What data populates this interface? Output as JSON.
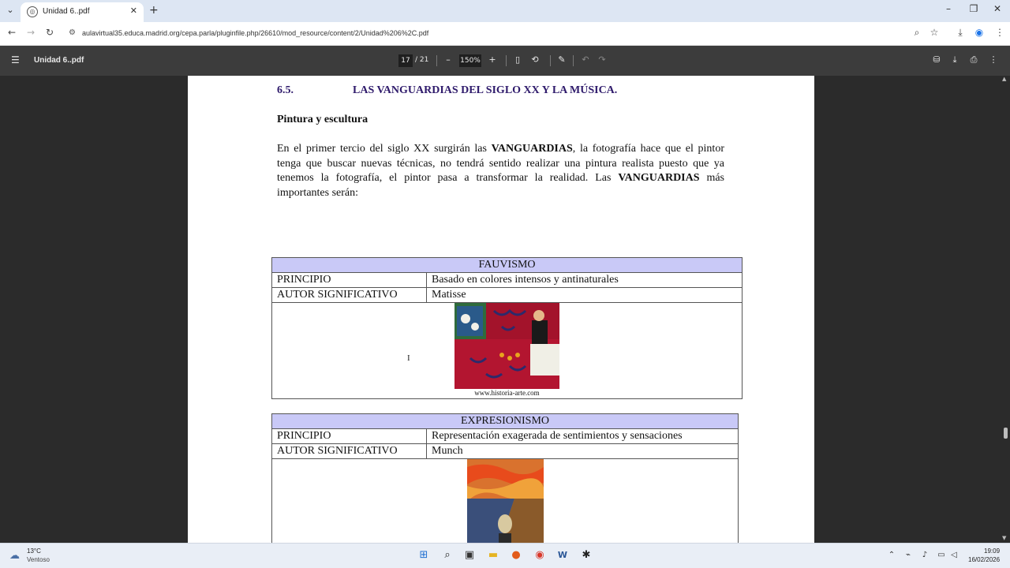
{
  "browser": {
    "tab_title": "Unidad 6..pdf",
    "url": "aulavirtual35.educa.madrid.org/cepa.parla/pluginfile.php/26610/mod_resource/content/2/Unidad%206%2C.pdf"
  },
  "pdf_toolbar": {
    "file_name": "Unidad 6..pdf",
    "current_page": "17",
    "total_pages": "/ 21",
    "zoom": "150%"
  },
  "document": {
    "section_number": "6.5.",
    "section_title": "LAS VANGUARDIAS DEL SIGLO XX Y LA MÚSICA.",
    "subheading": "Pintura y escultura",
    "intro": {
      "p1": "En el primer tercio del siglo XX surgirán las ",
      "b1": "VANGUARDIAS",
      "p2": ", la fotografía hace que el pintor tenga que buscar nuevas técnicas, no tendrá sentido realizar una pintura realista puesto que ya tenemos la fotografía, el pintor pasa a transformar la realidad. Las ",
      "b2": "VANGUARDIAS",
      "p3": " más importantes serán:"
    },
    "tables": [
      {
        "header": "FAUVISMO",
        "row1_label": "PRINCIPIO",
        "row1_value": "Basado en colores intensos y antinaturales",
        "row2_label": "AUTOR SIGNIFICATIVO",
        "row2_value": "Matisse",
        "caption": "www.historia-arte.com"
      },
      {
        "header": "EXPRESIONISMO",
        "row1_label": "PRINCIPIO",
        "row1_value": "Representación exagerada de sentimientos y sensaciones",
        "row2_label": "AUTOR SIGNIFICATIVO",
        "row2_value": "Munch"
      }
    ]
  },
  "taskbar": {
    "weather_temp": "13°C",
    "weather_desc": "Ventoso",
    "time": "19:09",
    "date": "16/02/2026"
  },
  "colors": {
    "table_header_bg": "#c9c9f7",
    "heading_color": "#2e1a6b",
    "pdf_toolbar_bg": "#3c3c3c"
  }
}
